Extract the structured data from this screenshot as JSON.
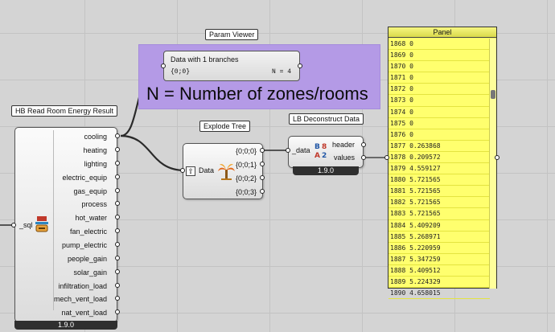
{
  "group": {
    "caption": "N = Number of zones/rooms"
  },
  "param_viewer": {
    "tag": "Param Viewer",
    "line1": "Data with 1 branches",
    "path": "{0;0}",
    "count": "N = 4"
  },
  "hb_node": {
    "tag": "HB Read Room Energy Result",
    "input": "_sql",
    "outputs": [
      "cooling",
      "heating",
      "lighting",
      "electric_equip",
      "gas_equip",
      "process",
      "hot_water",
      "fan_electric",
      "pump_electric",
      "people_gain",
      "solar_gain",
      "infiltration_load",
      "mech_vent_load",
      "nat_vent_load"
    ],
    "version": "1.9.0"
  },
  "explode_tree": {
    "tag": "Explode Tree",
    "input": "Data",
    "outputs": [
      "{0;0;0}",
      "{0;0;1}",
      "{0;0;2}",
      "{0;0;3}"
    ]
  },
  "deconstruct": {
    "tag": "LB Deconstruct Data",
    "input": "_data",
    "outputs": [
      "header",
      "values"
    ],
    "version": "1.9.0"
  },
  "panel": {
    "title": "Panel",
    "rows": [
      "1868 0",
      "1869 0",
      "1870 0",
      "1871 0",
      "1872 0",
      "1873 0",
      "1874 0",
      "1875 0",
      "1876 0",
      "1877 0.263868",
      "1878 0.209572",
      "1879 4.559127",
      "1880 5.721565",
      "1881 5.721565",
      "1882 5.721565",
      "1883 5.721565",
      "1884 5.409209",
      "1885 5.268971",
      "1886 5.220959",
      "1887 5.347259",
      "1888 5.409512",
      "1889 5.224329",
      "1890 4.658015"
    ]
  }
}
